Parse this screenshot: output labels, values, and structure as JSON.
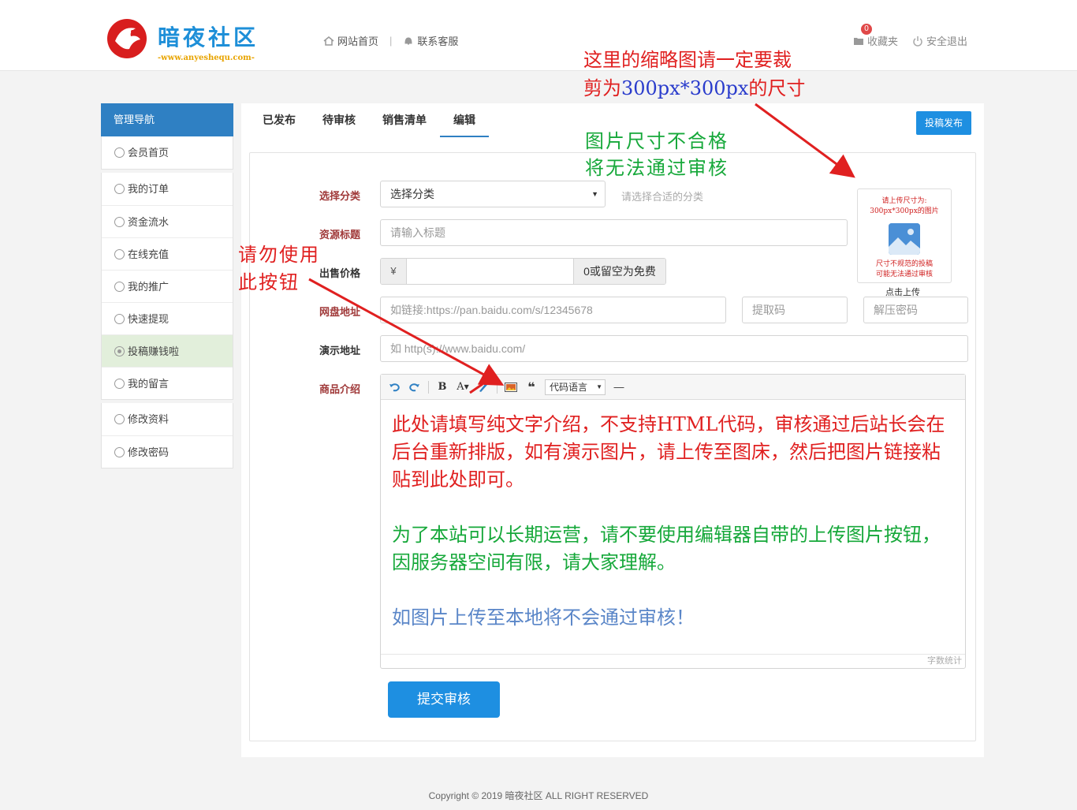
{
  "brand": {
    "name": "暗夜社区",
    "domain": "-www.anyeshequ.com-"
  },
  "topnav": {
    "home": "网站首页",
    "service": "联系客服",
    "separator": "|"
  },
  "topright": {
    "favorites": "收藏夹",
    "favorites_count": "0",
    "logout": "安全退出"
  },
  "annotations": {
    "top_line1": "这里的缩略图请一定要裁",
    "top_line2_prefix": "剪为",
    "top_line2_size": "300px*300px",
    "top_line2_suffix": "的尺寸",
    "green_line1": "图片尺寸不合格",
    "green_line2": "将无法通过审核",
    "left_line1": "请勿使用",
    "left_line2": "此按钮"
  },
  "sidebar": {
    "title": "管理导航",
    "groups": [
      [
        {
          "label": "会员首页"
        }
      ],
      [
        {
          "label": "我的订单"
        },
        {
          "label": "资金流水"
        },
        {
          "label": "在线充值"
        },
        {
          "label": "我的推广"
        },
        {
          "label": "快速提现"
        },
        {
          "label": "投稿赚钱啦"
        },
        {
          "label": "我的留言"
        }
      ],
      [
        {
          "label": "修改资料"
        },
        {
          "label": "修改密码"
        }
      ]
    ]
  },
  "tabs": [
    "已发布",
    "待审核",
    "销售清单",
    "编辑"
  ],
  "publish_button": "投稿发布",
  "form": {
    "category": {
      "label": "选择分类",
      "value": "选择分类",
      "hint": "请选择合适的分类"
    },
    "title": {
      "label": "资源标题",
      "placeholder": "请输入标题"
    },
    "price": {
      "label": "出售价格",
      "prefix": "¥",
      "suffix": "0或留空为免费"
    },
    "netdisk": {
      "label": "网盘地址",
      "placeholder": "如链接:https://pan.baidu.com/s/12345678",
      "code_placeholder": "提取码",
      "unzip_placeholder": "解压密码"
    },
    "demo": {
      "label": "演示地址",
      "placeholder": "如 http(s)://www.baidu.com/"
    },
    "intro": {
      "label": "商品介绍"
    }
  },
  "thumbnail": {
    "line1": "请上传尺寸为:",
    "line2": "300px*300px的图片",
    "line3": "尺寸不规范的投稿",
    "line4": "可能无法通过审核",
    "caption": "点击上传"
  },
  "editor": {
    "toolbar": {
      "bold": "B",
      "font": "A",
      "code_lang": "代码语言",
      "hr": "—"
    },
    "red_text": "此处请填写纯文字介绍，不支持HTML代码，审核通过后站长会在后台重新排版，如有演示图片，请上传至图床，然后把图片链接粘贴到此处即可。",
    "green_text": "为了本站可以长期运营，请不要使用编辑器自带的上传图片按钮，因服务器空间有限，请大家理解。",
    "blue_text": "如图片上传至本地将不会通过审核！",
    "word_count": "字数统计"
  },
  "submit_button": "提交审核",
  "footer": "Copyright © 2019 暗夜社区 ALL RIGHT RESERVED",
  "colors": {
    "primary": "#1e8fe1",
    "sidebar_head": "#2f80c3",
    "annotation_red": "#e02020",
    "annotation_green": "#16a83a",
    "annotation_blue": "#5a86c8"
  }
}
